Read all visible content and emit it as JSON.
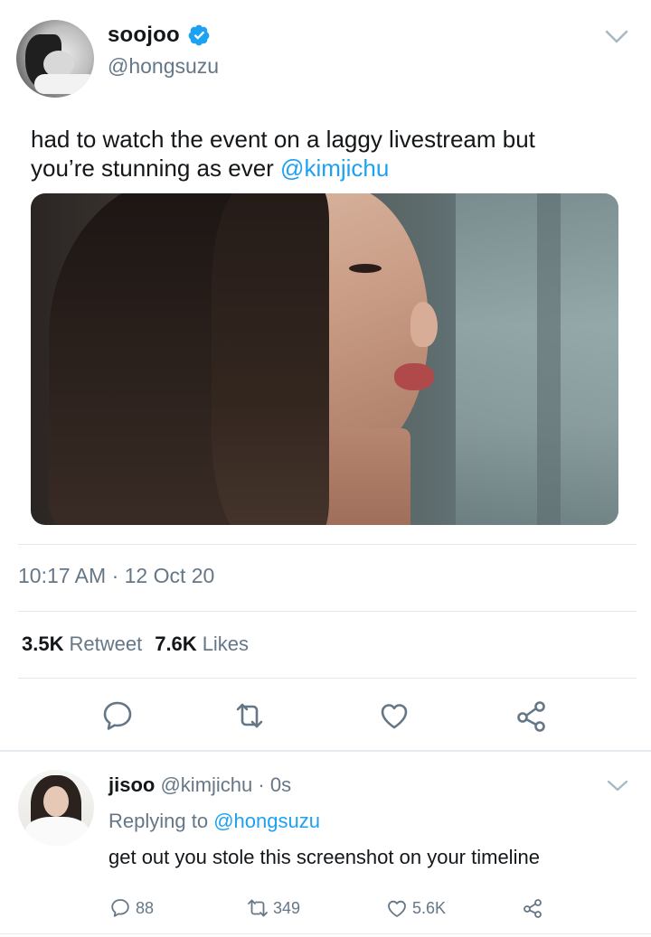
{
  "tweet": {
    "display_name": "soojoo",
    "handle": "@hongsuzu",
    "text_line1": "had to watch the event on a laggy livestream but",
    "text_line2_prefix": "you’re stunning as ever ",
    "mention": "@kimjichu",
    "timestamp": "10:17 AM · 12 Oct 20",
    "retweets_count": "3.5K",
    "retweets_label": "Retweet",
    "likes_count": "7.6K",
    "likes_label": "Likes",
    "icons": {
      "verified": "verified-badge-icon",
      "caret": "chevron-down-icon",
      "reply": "reply-icon",
      "retweet": "retweet-icon",
      "like": "heart-icon",
      "share": "share-icon"
    }
  },
  "reply": {
    "display_name": "jisoo",
    "handle": "@kimjichu",
    "time": "· 0s",
    "replying_prefix": "Replying to ",
    "replying_to": "@hongsuzu",
    "text": "get out you stole this screenshot on your timeline",
    "reply_count": "88",
    "retweet_count": "349",
    "like_count": "5.6K"
  },
  "colors": {
    "accent": "#1da1f2",
    "secondary_text": "#657786",
    "primary_text": "#14171a",
    "divider": "#e1e8ed"
  }
}
